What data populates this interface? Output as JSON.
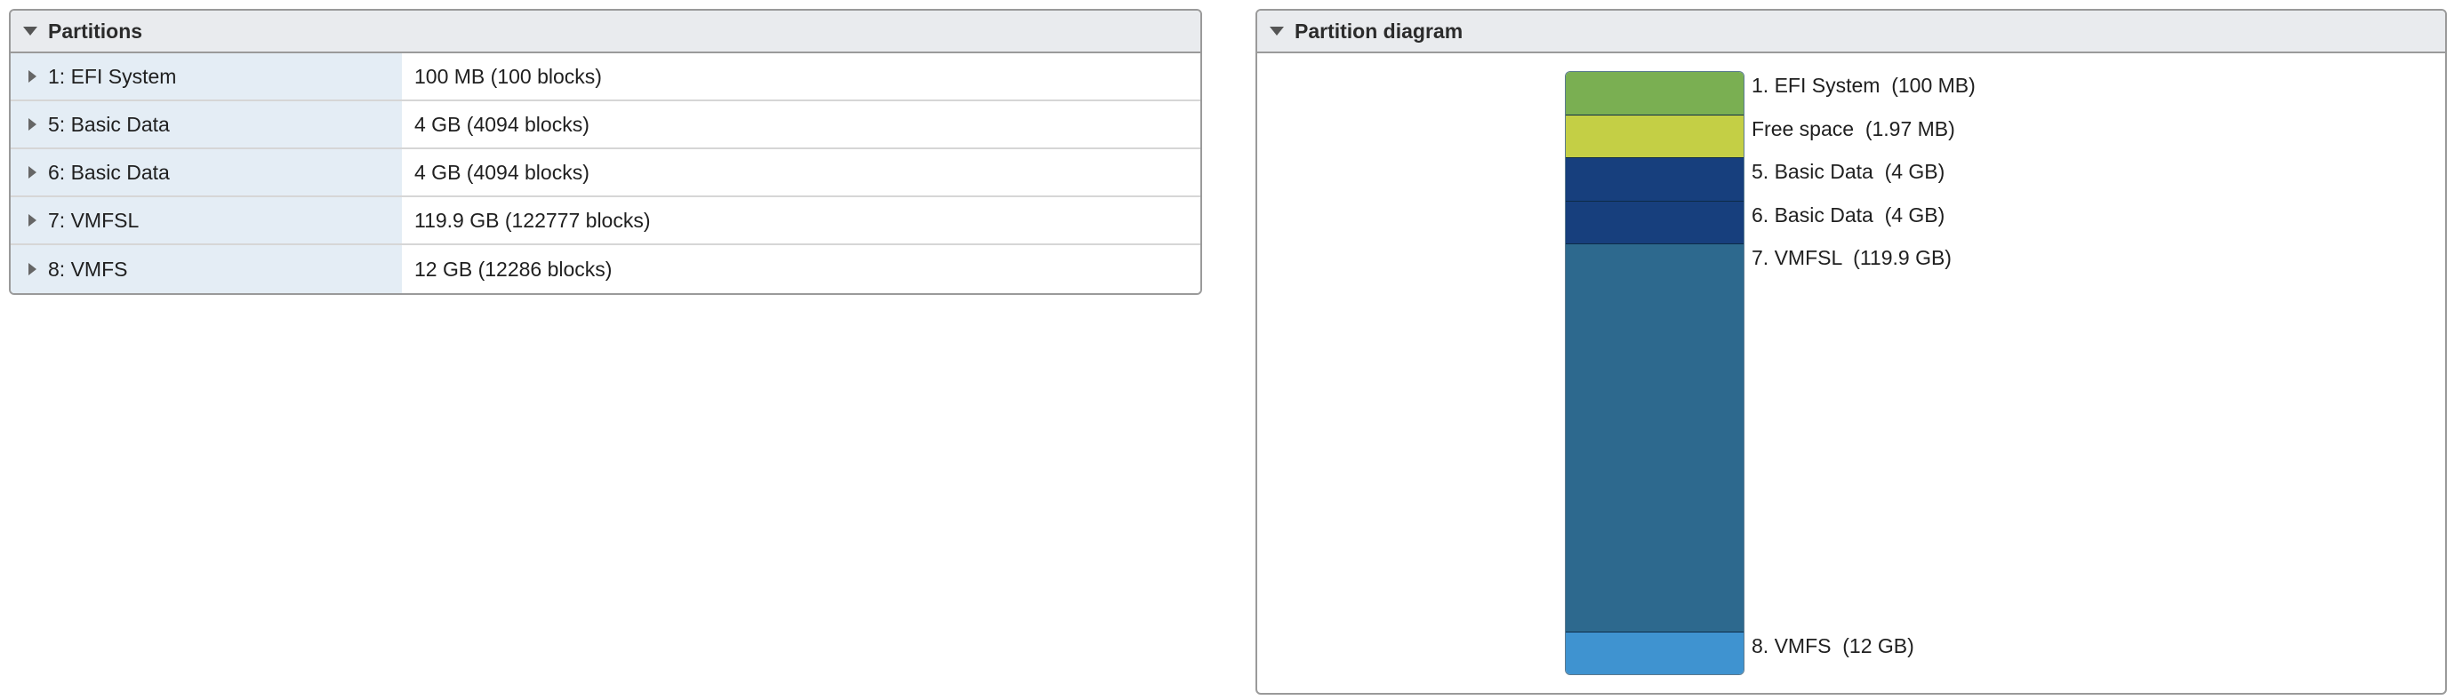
{
  "partitions_panel": {
    "title": "Partitions",
    "rows": [
      {
        "name": "1: EFI System",
        "size": "100 MB (100 blocks)"
      },
      {
        "name": "5: Basic Data",
        "size": "4 GB (4094 blocks)"
      },
      {
        "name": "6: Basic Data",
        "size": "4 GB (4094 blocks)"
      },
      {
        "name": "7: VMFSL",
        "size": "119.9 GB (122777 blocks)"
      },
      {
        "name": "8: VMFS",
        "size": "12 GB (12286 blocks)"
      }
    ]
  },
  "diagram_panel": {
    "title": "Partition diagram",
    "segments": [
      {
        "label": "1. EFI System  (100 MB)",
        "color": "#7aaf52",
        "share": 1
      },
      {
        "label": "Free space  (1.97 MB)",
        "color": "#c4cf45",
        "share": 1
      },
      {
        "label": "5. Basic Data  (4 GB)",
        "color": "#173f7d",
        "share": 1
      },
      {
        "label": "6. Basic Data  (4 GB)",
        "color": "#173f7d",
        "share": 1
      },
      {
        "label": "7. VMFSL  (119.9 GB)",
        "color": "#2d698e",
        "share": 9
      },
      {
        "label": "8. VMFS  (12 GB)",
        "color": "#3f93d0",
        "share": 1
      }
    ]
  }
}
